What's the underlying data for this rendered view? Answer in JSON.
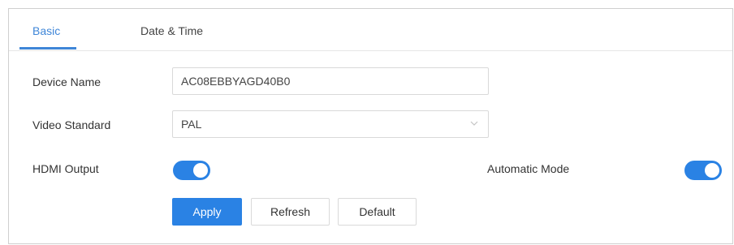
{
  "tabs": {
    "basic": "Basic",
    "date_time": "Date & Time",
    "active": "Basic"
  },
  "form": {
    "device_name_label": "Device Name",
    "device_name_value": "AC08EBBYAGD40B0",
    "video_standard_label": "Video Standard",
    "video_standard_value": "PAL",
    "hdmi_output_label": "HDMI Output",
    "hdmi_output_on": true,
    "automatic_mode_label": "Automatic Mode",
    "automatic_mode_on": true
  },
  "buttons": {
    "apply": "Apply",
    "refresh": "Refresh",
    "default": "Default"
  },
  "colors": {
    "accent": "#2a82e4",
    "tab_active": "#3f86d8"
  },
  "icons": {
    "dropdown": "chevron-down-icon"
  }
}
